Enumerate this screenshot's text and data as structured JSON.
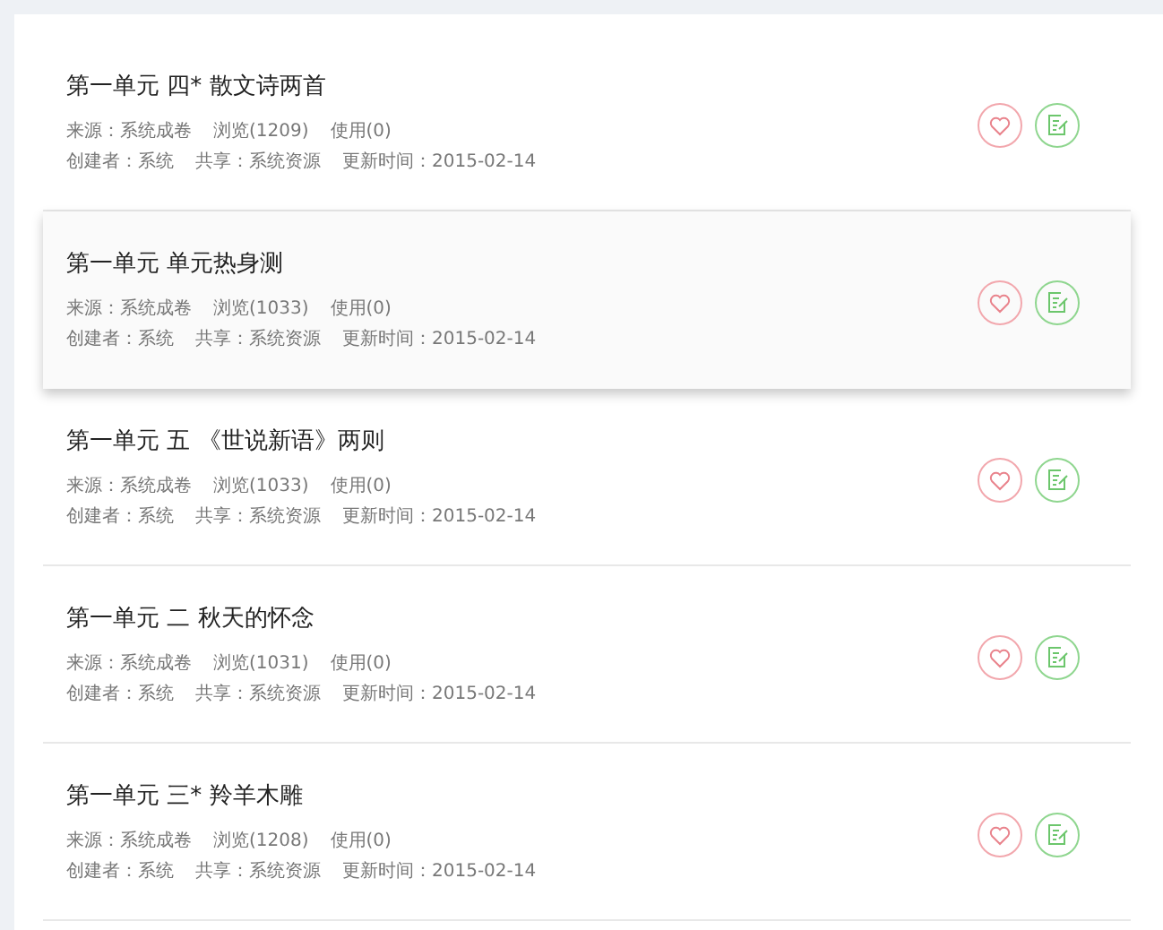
{
  "items": [
    {
      "title": "第一单元 四* 散文诗两首",
      "source": "来源：系统成卷",
      "views": "浏览(1209)",
      "uses": "使用(0)",
      "creator": "创建者：系统",
      "share": "共享：系统资源",
      "updated": "更新时间：2015-02-14",
      "highlighted": false
    },
    {
      "title": "第一单元 单元热身测",
      "source": "来源：系统成卷",
      "views": "浏览(1033)",
      "uses": "使用(0)",
      "creator": "创建者：系统",
      "share": "共享：系统资源",
      "updated": "更新时间：2015-02-14",
      "highlighted": true
    },
    {
      "title": "第一单元 五 《世说新语》两则",
      "source": "来源：系统成卷",
      "views": "浏览(1033)",
      "uses": "使用(0)",
      "creator": "创建者：系统",
      "share": "共享：系统资源",
      "updated": "更新时间：2015-02-14",
      "highlighted": false
    },
    {
      "title": "第一单元 二 秋天的怀念",
      "source": "来源：系统成卷",
      "views": "浏览(1031)",
      "uses": "使用(0)",
      "creator": "创建者：系统",
      "share": "共享：系统资源",
      "updated": "更新时间：2015-02-14",
      "highlighted": false
    },
    {
      "title": "第一单元 三* 羚羊木雕",
      "source": "来源：系统成卷",
      "views": "浏览(1208)",
      "uses": "使用(0)",
      "creator": "创建者：系统",
      "share": "共享：系统资源",
      "updated": "更新时间：2015-02-14",
      "highlighted": false
    }
  ]
}
